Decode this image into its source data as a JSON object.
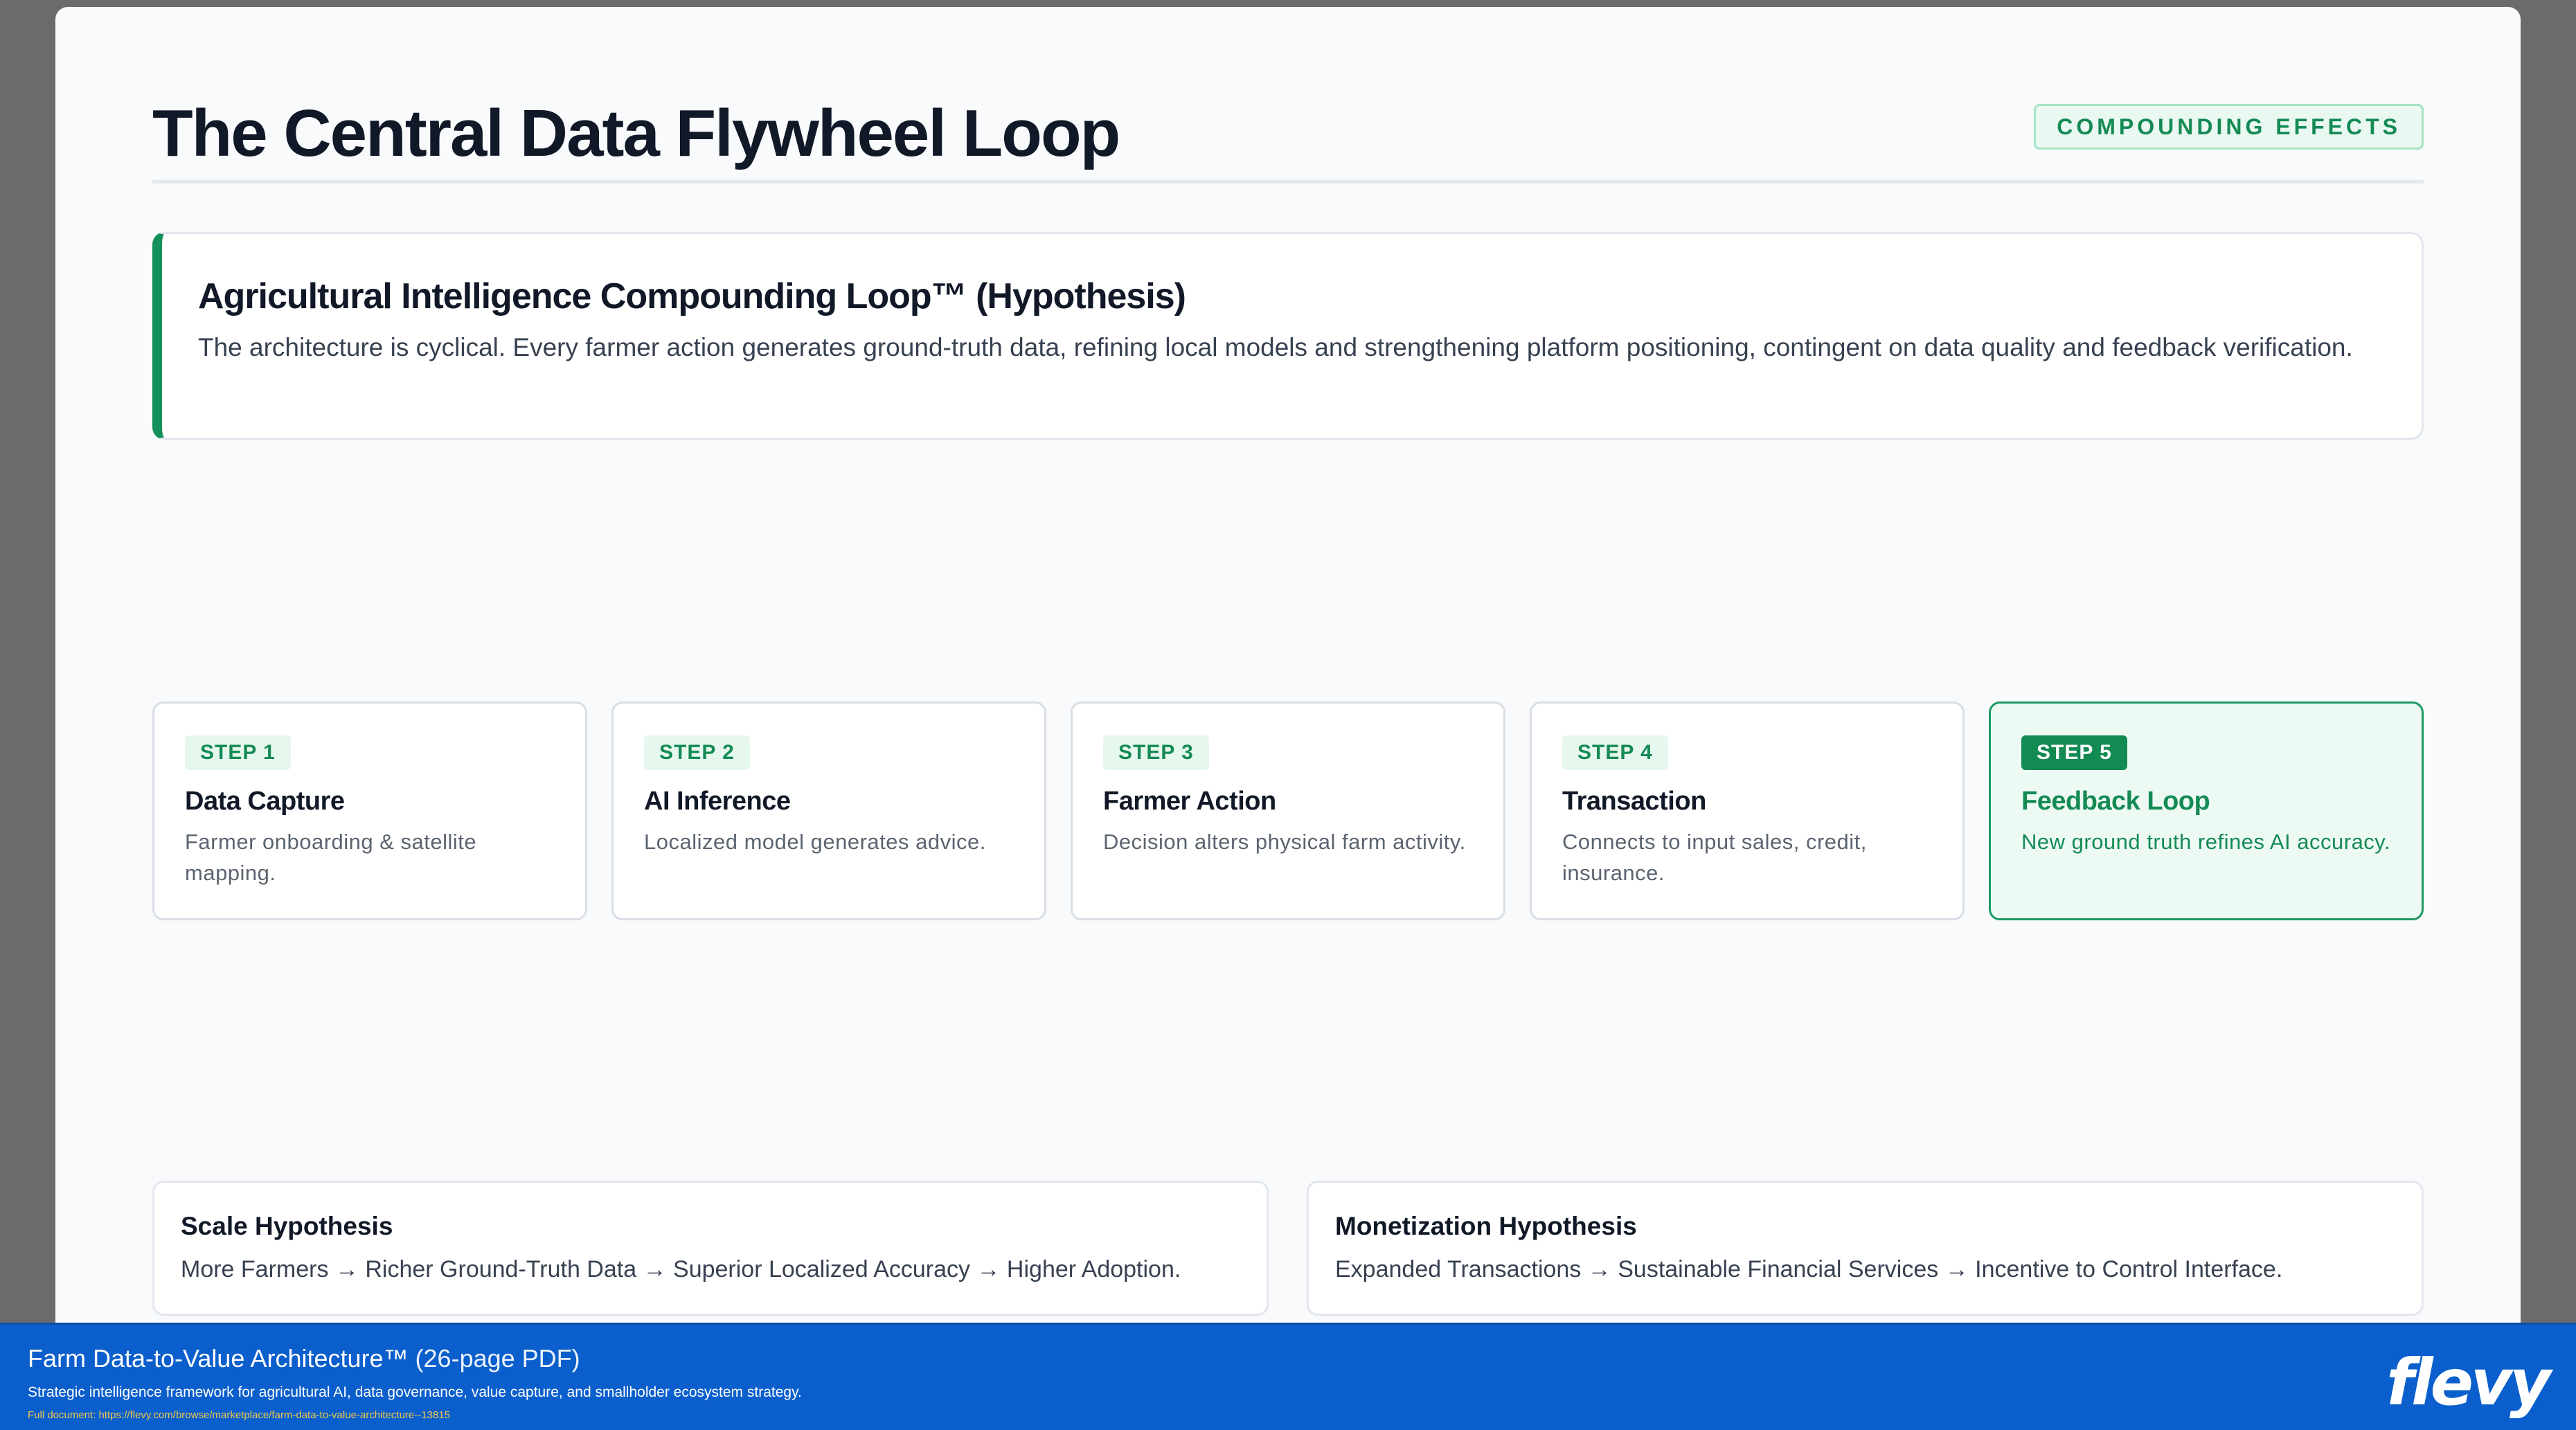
{
  "slide": {
    "title": "The Central Data Flywheel Loop",
    "badge": "COMPOUNDING EFFECTS"
  },
  "callout": {
    "title": "Agricultural Intelligence Compounding Loop™ (Hypothesis)",
    "text": "The architecture is cyclical. Every farmer action generates ground-truth data, refining local models and strengthening platform positioning, contingent on data quality and feedback verification."
  },
  "steps": [
    {
      "badge": "STEP 1",
      "title": "Data Capture",
      "desc": "Farmer onboarding & satellite mapping."
    },
    {
      "badge": "STEP 2",
      "title": "AI Inference",
      "desc": "Localized model generates advice."
    },
    {
      "badge": "STEP 3",
      "title": "Farmer Action",
      "desc": "Decision alters physical farm activity."
    },
    {
      "badge": "STEP 4",
      "title": "Transaction",
      "desc": "Connects to input sales, credit, insurance."
    },
    {
      "badge": "STEP 5",
      "title": "Feedback Loop",
      "desc": "New ground truth refines AI accuracy."
    }
  ],
  "hypotheses": [
    {
      "title": "Scale Hypothesis",
      "text": "More Farmers → Richer Ground-Truth Data → Superior Localized Accuracy → Higher Adoption."
    },
    {
      "title": "Monetization Hypothesis",
      "text": "Expanded Transactions → Sustainable Financial Services → Incentive to Control Interface."
    }
  ],
  "footer": {
    "title": "Farm Data-to-Value Architecture™",
    "pages": "(26-page PDF)",
    "desc": "Strategic intelligence framework for agricultural AI, data governance, value capture, and smallholder ecosystem strategy.",
    "link": "Full document: https://flevy.com/browse/marketplace/farm-data-to-value-architecture--13815",
    "logo": "flevy"
  },
  "colors": {
    "accent": "#14915a",
    "footer_bg": "#0b5fcc"
  }
}
